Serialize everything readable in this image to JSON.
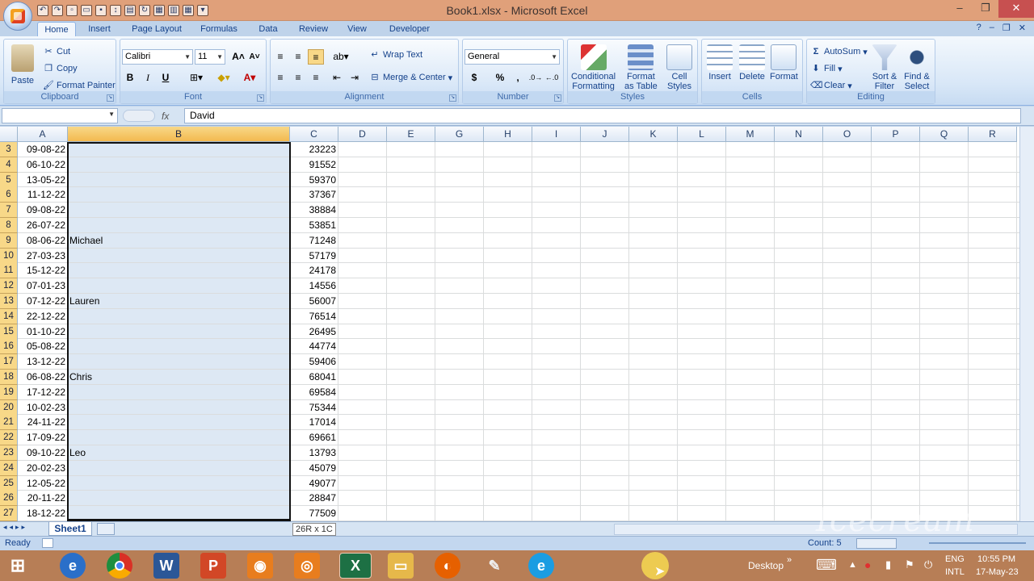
{
  "window": {
    "title": "Book1.xlsx - Microsoft Excel",
    "min": "–",
    "restore": "❐",
    "close": "✕"
  },
  "tabs": [
    "Home",
    "Insert",
    "Page Layout",
    "Formulas",
    "Data",
    "Review",
    "View",
    "Developer"
  ],
  "ribbon": {
    "clipboard": {
      "label": "Clipboard",
      "paste": "Paste",
      "cut": "Cut",
      "copy": "Copy",
      "format_painter": "Format Painter"
    },
    "font": {
      "label": "Font",
      "name": "Calibri",
      "size": "11",
      "bold": "B",
      "italic": "I",
      "underline": "U"
    },
    "alignment": {
      "label": "Alignment",
      "wrap": "Wrap Text",
      "merge": "Merge & Center"
    },
    "number": {
      "label": "Number",
      "format": "General",
      "currency": "$",
      "percent": "%",
      "comma": ","
    },
    "styles": {
      "label": "Styles",
      "conditional": "Conditional",
      "conditional2": "Formatting",
      "format_table": "Format",
      "format_table2": "as Table",
      "cell_styles": "Cell",
      "cell_styles2": "Styles"
    },
    "cells": {
      "label": "Cells",
      "insert": "Insert",
      "delete": "Delete",
      "format": "Format"
    },
    "editing": {
      "label": "Editing",
      "autosum": "AutoSum",
      "fill": "Fill",
      "clear": "Clear",
      "sort": "Sort &",
      "sort2": "Filter",
      "find": "Find &",
      "find2": "Select"
    }
  },
  "formula_bar": {
    "name_box": "",
    "fx": "fx",
    "content": "David"
  },
  "columns": [
    "A",
    "B",
    "C",
    "D",
    "E",
    "G",
    "H",
    "I",
    "J",
    "K",
    "L",
    "M",
    "N",
    "O",
    "P",
    "Q",
    "R"
  ],
  "rows": [
    {
      "n": "3",
      "a": "09-08-22",
      "b": "",
      "c": "23223"
    },
    {
      "n": "4",
      "a": "06-10-22",
      "b": "",
      "c": "91552"
    },
    {
      "n": "5",
      "a": "13-05-22",
      "b": "",
      "c": "59370"
    },
    {
      "n": "6",
      "a": "11-12-22",
      "b": "",
      "c": "37367"
    },
    {
      "n": "7",
      "a": "09-08-22",
      "b": "",
      "c": "38884"
    },
    {
      "n": "8",
      "a": "26-07-22",
      "b": "",
      "c": "53851"
    },
    {
      "n": "9",
      "a": "08-06-22",
      "b": "Michael",
      "c": "71248"
    },
    {
      "n": "10",
      "a": "27-03-23",
      "b": "",
      "c": "57179"
    },
    {
      "n": "11",
      "a": "15-12-22",
      "b": "",
      "c": "24178"
    },
    {
      "n": "12",
      "a": "07-01-23",
      "b": "",
      "c": "14556"
    },
    {
      "n": "13",
      "a": "07-12-22",
      "b": "Lauren",
      "c": "56007"
    },
    {
      "n": "14",
      "a": "22-12-22",
      "b": "",
      "c": "76514"
    },
    {
      "n": "15",
      "a": "01-10-22",
      "b": "",
      "c": "26495"
    },
    {
      "n": "16",
      "a": "05-08-22",
      "b": "",
      "c": "44774"
    },
    {
      "n": "17",
      "a": "13-12-22",
      "b": "",
      "c": "59406"
    },
    {
      "n": "18",
      "a": "06-08-22",
      "b": "Chris",
      "c": "68041"
    },
    {
      "n": "19",
      "a": "17-12-22",
      "b": "",
      "c": "69584"
    },
    {
      "n": "20",
      "a": "10-02-23",
      "b": "",
      "c": "75344"
    },
    {
      "n": "21",
      "a": "24-11-22",
      "b": "",
      "c": "17014"
    },
    {
      "n": "22",
      "a": "17-09-22",
      "b": "",
      "c": "69661"
    },
    {
      "n": "23",
      "a": "09-10-22",
      "b": "Leo",
      "c": "13793"
    },
    {
      "n": "24",
      "a": "20-02-23",
      "b": "",
      "c": "45079"
    },
    {
      "n": "25",
      "a": "12-05-22",
      "b": "",
      "c": "49077"
    },
    {
      "n": "26",
      "a": "20-11-22",
      "b": "",
      "c": "28847"
    },
    {
      "n": "27",
      "a": "18-12-22",
      "b": "",
      "c": "77509"
    }
  ],
  "sheet": {
    "tab": "Sheet1",
    "size_tip": "26R x 1C"
  },
  "status": {
    "ready": "Ready",
    "count": "Count: 5"
  },
  "taskbar": {
    "desktop": "Desktop",
    "lang1": "ENG",
    "lang2": "INTL",
    "time": "10:55 PM",
    "date": "17-May-23"
  },
  "watermark": "Icecream"
}
